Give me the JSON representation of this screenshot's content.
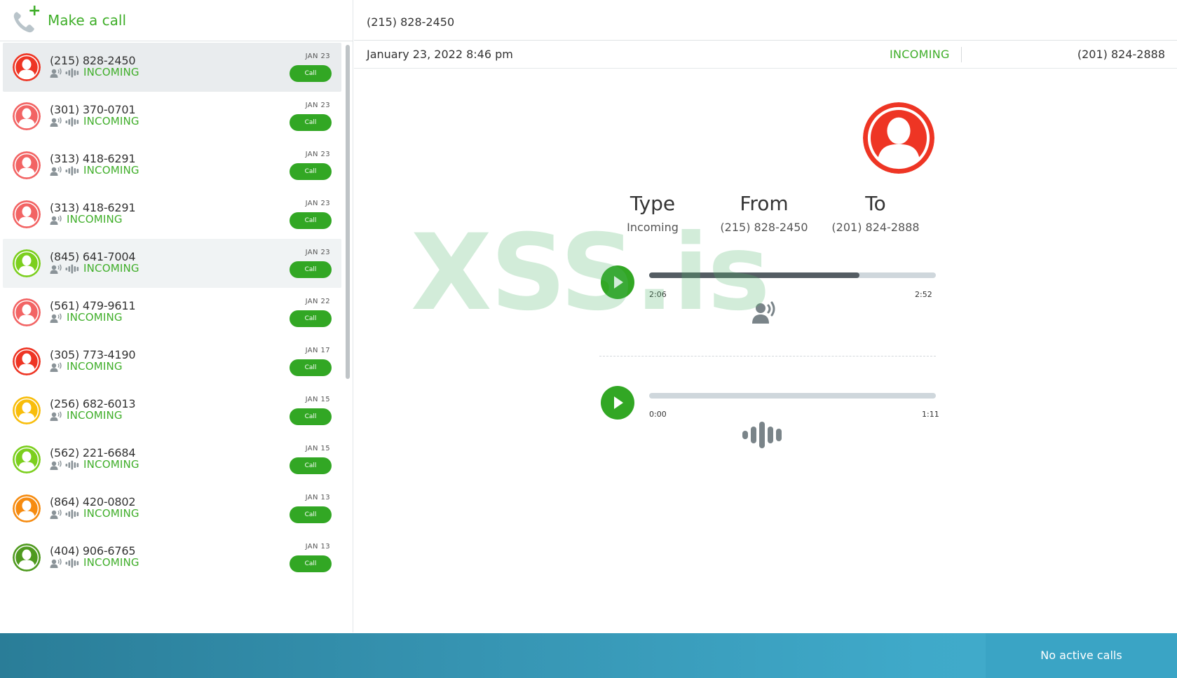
{
  "make_call": {
    "label": "Make a call",
    "icon": "phone-add-icon"
  },
  "call_list": [
    {
      "number": "(215) 828-2450",
      "status": "INCOMING",
      "date": "JAN 23",
      "button": "Call",
      "avatar_color": "#ee3524",
      "has_recording": true,
      "selected": true
    },
    {
      "number": "(301) 370-0701",
      "status": "INCOMING",
      "date": "JAN 23",
      "button": "Call",
      "avatar_color": "#f26464",
      "has_recording": true
    },
    {
      "number": "(313) 418-6291",
      "status": "INCOMING",
      "date": "JAN 23",
      "button": "Call",
      "avatar_color": "#f26464",
      "has_recording": true
    },
    {
      "number": "(313) 418-6291",
      "status": "INCOMING",
      "date": "JAN 23",
      "button": "Call",
      "avatar_color": "#f26464",
      "has_recording": false
    },
    {
      "number": "(845) 641-7004",
      "status": "INCOMING",
      "date": "JAN 23",
      "button": "Call",
      "avatar_color": "#7ccf1e",
      "has_recording": true,
      "hovered": true
    },
    {
      "number": "(561) 479-9611",
      "status": "INCOMING",
      "date": "JAN 22",
      "button": "Call",
      "avatar_color": "#f26464",
      "has_recording": false
    },
    {
      "number": "(305) 773-4190",
      "status": "INCOMING",
      "date": "JAN 17",
      "button": "Call",
      "avatar_color": "#ee3524",
      "has_recording": false
    },
    {
      "number": "(256) 682-6013",
      "status": "INCOMING",
      "date": "JAN 15",
      "button": "Call",
      "avatar_color": "#f8bd0b",
      "has_recording": false
    },
    {
      "number": "(562) 221-6684",
      "status": "INCOMING",
      "date": "JAN 15",
      "button": "Call",
      "avatar_color": "#7ccf1e",
      "has_recording": true
    },
    {
      "number": "(864) 420-0802",
      "status": "INCOMING",
      "date": "JAN 13",
      "button": "Call",
      "avatar_color": "#f68b10",
      "has_recording": true
    },
    {
      "number": "(404) 906-6765",
      "status": "INCOMING",
      "date": "JAN 13",
      "button": "Call",
      "avatar_color": "#4f9a1f",
      "has_recording": true
    }
  ],
  "detail": {
    "title": "(215) 828-2450",
    "datetime": "January 23, 2022 8:46 pm",
    "direction": "INCOMING",
    "to_number": "(201) 824-2888",
    "avatar_color": "#ee3524",
    "columns": [
      {
        "heading": "Type",
        "value": "Incoming"
      },
      {
        "heading": "From",
        "value": "(215) 828-2450"
      },
      {
        "heading": "To",
        "value": "(201) 824-2888"
      }
    ],
    "players": [
      {
        "current": "2:06",
        "total": "2:52",
        "progress": 0.733,
        "icon": "voicemail-speaker-icon"
      },
      {
        "current": "0:00",
        "total": "1:11",
        "progress": 0.0,
        "icon": "audio-waveform-icon"
      }
    ]
  },
  "watermark": "XSS.is",
  "footer": {
    "status": "No active calls"
  }
}
